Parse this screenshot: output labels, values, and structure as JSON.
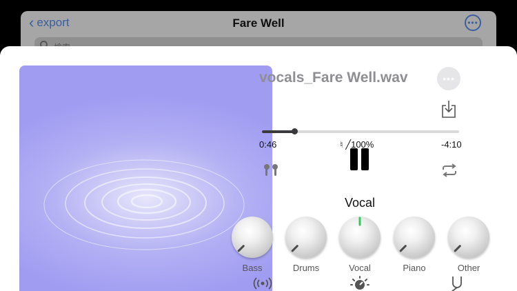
{
  "background": {
    "back_label": "export",
    "title": "Fare Well",
    "search_placeholder": "検索"
  },
  "player": {
    "track_title": "vocals_Fare Well.wav",
    "elapsed": "0:46",
    "remaining": "-4:10",
    "pitch_speed": "♮ ╱100%",
    "progress_fraction": 0.165,
    "mixer_title": "Vocal",
    "knobs": [
      {
        "label": "Bass",
        "level": 0.0,
        "active": false
      },
      {
        "label": "Drums",
        "level": 0.0,
        "active": false
      },
      {
        "label": "Vocal",
        "level": 0.5,
        "active": true
      },
      {
        "label": "Piano",
        "level": 0.0,
        "active": false
      },
      {
        "label": "Other",
        "level": 0.0,
        "active": false
      }
    ],
    "accent_color": "#34c759",
    "artwork_color": "#a7a3f3"
  }
}
